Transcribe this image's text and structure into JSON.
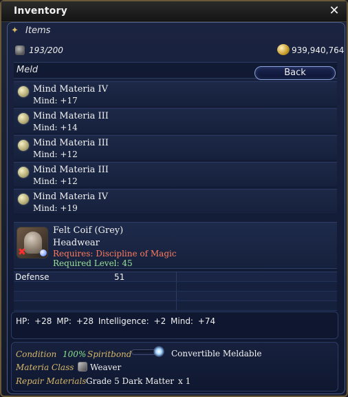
{
  "window": {
    "title": "Inventory",
    "close_symbol": "✕"
  },
  "inventory": {
    "section_title": "Items",
    "capacity": "193/200",
    "gil": "939,940,764"
  },
  "meld": {
    "label": "Meld",
    "back_button": "Back",
    "materia": [
      {
        "name": "Mind Materia IV",
        "value": "Mind: +17"
      },
      {
        "name": "Mind Materia III",
        "value": "Mind: +14"
      },
      {
        "name": "Mind Materia III",
        "value": "Mind: +12"
      },
      {
        "name": "Mind Materia III",
        "value": "Mind: +12"
      },
      {
        "name": "Mind Materia IV",
        "value": "Mind: +19"
      }
    ]
  },
  "item": {
    "name": "Felt Coif (Grey)",
    "type": "Headwear",
    "requires": "Requires: Discipline of Magic",
    "required_level": "Required Level: 45",
    "defense_label": "Defense",
    "defense_value": "51",
    "bonuses": "HP: +28   MP: +28   Intelligence: +2   Mind: +74"
  },
  "footer": {
    "condition_label": "Condition",
    "condition_value": "100%",
    "spiritbond_label": "Spiritbond",
    "status": "Convertible Meldable",
    "materia_class_label": "Materia Class",
    "materia_class_value": "Weaver",
    "repair_label": "Repair Materials",
    "repair_value": "Grade 5 Dark Matter",
    "repair_qty": "x 1"
  }
}
